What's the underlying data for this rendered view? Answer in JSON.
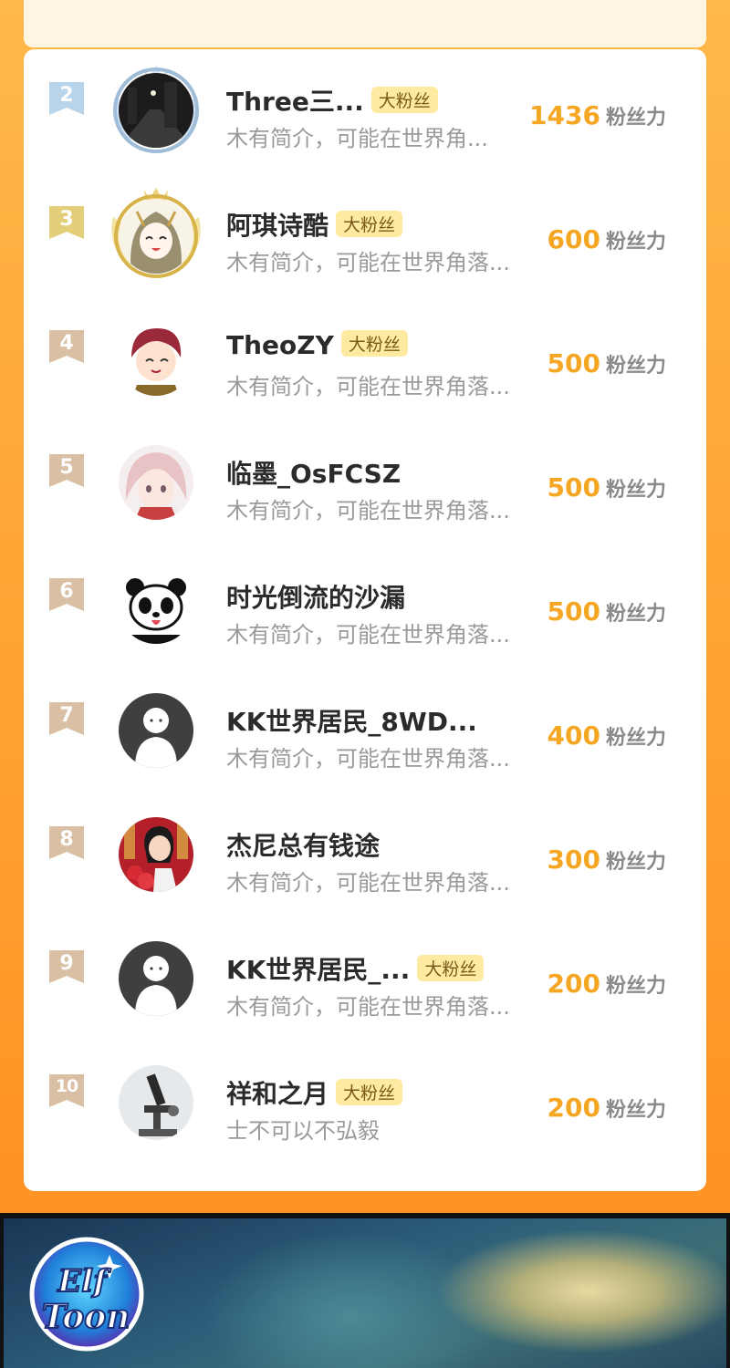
{
  "colors": {
    "accent_score": "#f5a623",
    "badge_bg": "#ffeaa1",
    "frame_orange": "#ffa233"
  },
  "fan_unit": "粉丝力",
  "rows": [
    {
      "rank": "2",
      "name": "Three三...",
      "badge": "大粉丝",
      "desc": "木有简介，可能在世界角...",
      "score": "1436"
    },
    {
      "rank": "3",
      "name": "阿琪诗酷",
      "badge": "大粉丝",
      "desc": "木有简介，可能在世界角落...",
      "score": "600"
    },
    {
      "rank": "4",
      "name": "TheoZY",
      "badge": "大粉丝",
      "desc": "木有简介，可能在世界角落...",
      "score": "500"
    },
    {
      "rank": "5",
      "name": "临墨_OsFCSZ",
      "badge": "",
      "desc": "木有简介，可能在世界角落...",
      "score": "500"
    },
    {
      "rank": "6",
      "name": "时光倒流的沙漏",
      "badge": "",
      "desc": "木有简介，可能在世界角落...",
      "score": "500"
    },
    {
      "rank": "7",
      "name": "KK世界居民_8WD...",
      "badge": "",
      "desc": "木有简介，可能在世界角落...",
      "score": "400"
    },
    {
      "rank": "8",
      "name": "杰尼总有钱途",
      "badge": "",
      "desc": "木有简介，可能在世界角落...",
      "score": "300"
    },
    {
      "rank": "9",
      "name": "KK世界居民_...",
      "badge": "大粉丝",
      "desc": "木有简介，可能在世界角落...",
      "score": "200"
    },
    {
      "rank": "10",
      "name": "祥和之月",
      "badge": "大粉丝",
      "desc": "士不可以不弘毅",
      "score": "200"
    }
  ],
  "banner": {
    "logo_line1": "Elf",
    "logo_line2": "Toon"
  }
}
